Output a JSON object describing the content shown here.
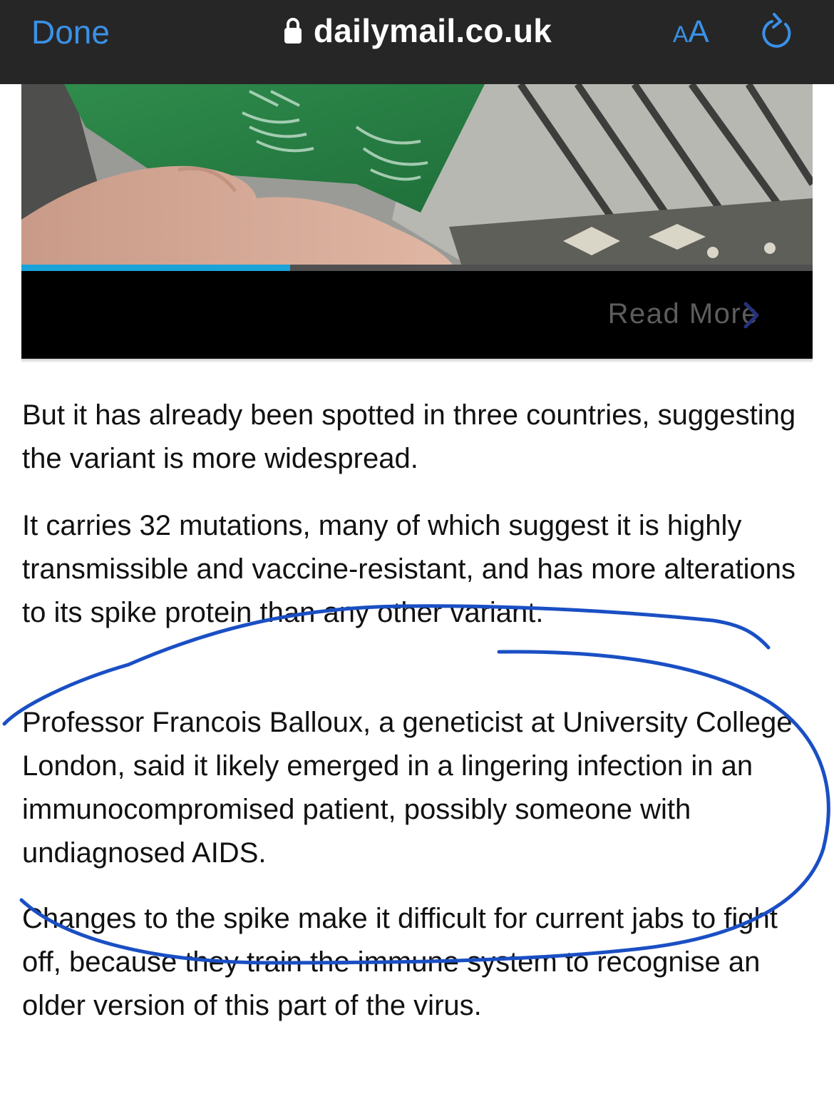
{
  "browser": {
    "done_label": "Done",
    "url": "dailymail.co.uk",
    "text_size_small": "A",
    "text_size_large": "A",
    "accent_color": "#3a91e8",
    "lock_icon": "lock-icon",
    "reload_icon": "reload-icon"
  },
  "video": {
    "progress": 0.34,
    "progress_color": "#1aa3d9",
    "read_more_label": "Read More",
    "chevron_icon": "chevron-right-icon"
  },
  "article": {
    "paragraphs": [
      "But it has already been spotted in three countries, suggesting the variant is more widespread.",
      "It carries 32 mutations, many of which suggest it is highly transmissible and vaccine-resistant, and has more alterations to its spike protein than any other variant.",
      "Professor Francois Balloux, a geneticist at University College London, said it likely emerged in a lingering infection in an immunocompromised patient, possibly someone with undiagnosed AIDS.",
      "Changes to the spike make it difficult for current jabs to fight off, because they train the immune system to recognise an older version of this part of the virus."
    ]
  },
  "annotation": {
    "ink_color": "#1a4fc4"
  }
}
